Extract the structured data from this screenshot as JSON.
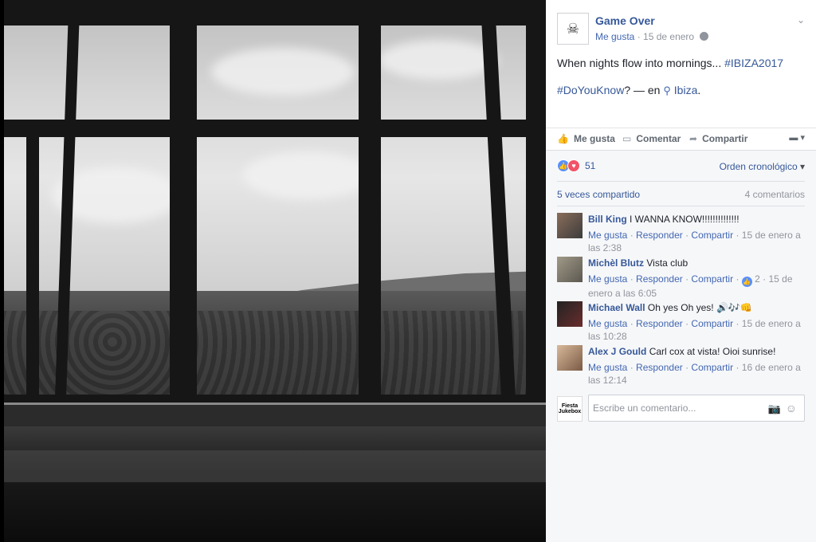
{
  "post": {
    "page_name": "Game Over",
    "meta_like": "Me gusta",
    "meta_sep": "·",
    "meta_date": "15 de enero",
    "text_line1_plain": "When nights flow into mornings... ",
    "text_line1_tag": "#IBIZA2017",
    "text_line2_tag": "#DoYouKnow",
    "text_line2_rest": "? — en ",
    "location": "Ibiza",
    "location_end": "."
  },
  "actions": {
    "like": "Me gusta",
    "comment": "Comentar",
    "share": "Compartir"
  },
  "stats": {
    "reaction_count": "51",
    "order_label": "Orden cronológico",
    "shares": "5 veces compartido",
    "comments": "4 comentarios"
  },
  "comments": [
    {
      "name": "Bill King",
      "text": "I WANNA KNOW!!!!!!!!!!!!!!",
      "like": "Me gusta",
      "reply": "Responder",
      "share": "Compartir",
      "time_line1": "15 de enero a",
      "time_line2": "las 2:38"
    },
    {
      "name": "Michèl Blutz",
      "text": "Vista club",
      "like": "Me gusta",
      "reply": "Responder",
      "share": "Compartir",
      "likes": "2",
      "time_line1": "15 de",
      "time_line2": "enero a las 6:05"
    },
    {
      "name": "Michael Wall",
      "text": "Oh yes Oh yes! 🔊🎶👊",
      "like": "Me gusta",
      "reply": "Responder",
      "share": "Compartir",
      "time_line1": "15 de enero a",
      "time_line2": "las 10:28"
    },
    {
      "name": "Alex J Gould",
      "text": "Carl cox at vista! Oioi sunrise!",
      "like": "Me gusta",
      "reply": "Responder",
      "share": "Compartir",
      "time_line1": "16 de enero a",
      "time_line2": "las 12:14"
    }
  ],
  "reply": {
    "placeholder": "Escribe un comentario...",
    "avatar_text": "Fiesta Jukebox"
  },
  "icons": {
    "globe": "globe-icon",
    "caret": "chevron-down-icon",
    "like": "thumbs-up-icon",
    "comment": "speech-bubble-icon",
    "share": "share-arrow-icon",
    "pin": "location-pin-icon",
    "camera": "camera-icon",
    "smile": "emoji-icon"
  },
  "colors": {
    "link": "#365899",
    "muted": "#90949c",
    "like_blue": "#5890ff",
    "love_red": "#f25268"
  }
}
